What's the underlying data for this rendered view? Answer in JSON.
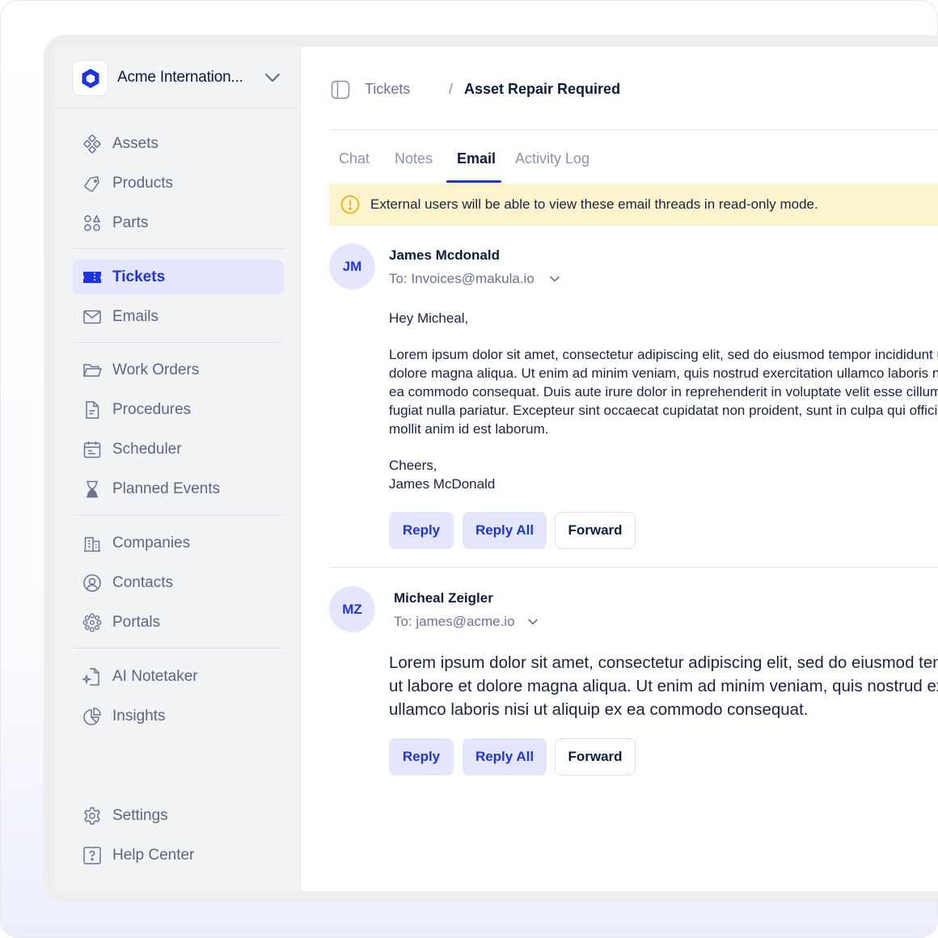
{
  "org": {
    "name": "Acme Internation..."
  },
  "nav": {
    "items": [
      {
        "label": "Assets",
        "icon": "assets-icon"
      },
      {
        "label": "Products",
        "icon": "tag-icon"
      },
      {
        "label": "Parts",
        "icon": "parts-icon"
      },
      {
        "label": "Tickets",
        "icon": "ticket-icon",
        "active": true
      },
      {
        "label": "Emails",
        "icon": "mail-icon"
      },
      {
        "label": "Work Orders",
        "icon": "folder-icon"
      },
      {
        "label": "Procedures",
        "icon": "document-icon"
      },
      {
        "label": "Scheduler",
        "icon": "calendar-icon"
      },
      {
        "label": "Planned Events",
        "icon": "hourglass-icon"
      },
      {
        "label": "Companies",
        "icon": "building-icon"
      },
      {
        "label": "Contacts",
        "icon": "user-circle-icon"
      },
      {
        "label": "Portals",
        "icon": "portal-icon"
      },
      {
        "label": "AI Notetaker",
        "icon": "ai-notetaker-icon"
      },
      {
        "label": "Insights",
        "icon": "pie-chart-icon"
      }
    ],
    "bottom": [
      {
        "label": "Settings",
        "icon": "gear-icon"
      },
      {
        "label": "Help Center",
        "icon": "help-icon"
      }
    ]
  },
  "breadcrumb": {
    "parent": "Tickets",
    "separator": "/",
    "current": "Asset Repair Required"
  },
  "tabs": [
    "Chat",
    "Notes",
    "Email",
    "Activity Log"
  ],
  "active_tab": "Email",
  "banner": {
    "text": "External users will be able to view these email threads in read-only mode."
  },
  "emails": [
    {
      "initials": "JM",
      "sender": "James Mcdonald",
      "to": "To: Invoices@makula.io",
      "greeting": "Hey Micheal,",
      "body_lines": [
        "Lorem ipsum dolor sit amet, consectetur adipiscing elit, sed do eiusmod tempor incididunt ut labore et",
        "dolore magna aliqua. Ut enim ad minim veniam, quis nostrud exercitation ullamco laboris nisi ut aliquip ex",
        "ea commodo consequat. Duis aute irure dolor in reprehenderit in voluptate velit esse cillum dolore eu",
        "fugiat nulla pariatur. Excepteur sint occaecat cupidatat non proident, sunt in culpa qui officia deserunt",
        "mollit anim id est laborum."
      ],
      "signoff": "Cheers,",
      "signature": "James McDonald",
      "reply": "Reply",
      "reply_all": "Reply All",
      "forward": "Forward"
    },
    {
      "initials": "MZ",
      "sender": "Micheal Zeigler",
      "to": "To: james@acme.io",
      "body_lines": [
        "Lorem ipsum dolor sit amet, consectetur adipiscing elit, sed do eiusmod tempor incididunt",
        "ut labore et dolore magna aliqua. Ut enim ad minim veniam, quis nostrud exercitation",
        "ullamco laboris nisi ut aliquip ex ea commodo consequat."
      ],
      "reply": "Reply",
      "reply_all": "Reply All",
      "forward": "Forward"
    }
  ],
  "colors": {
    "accent": "#1f34e0",
    "accent_soft": "#e3e6fc",
    "banner": "#fdf4cd",
    "warning": "#e8b10e"
  }
}
